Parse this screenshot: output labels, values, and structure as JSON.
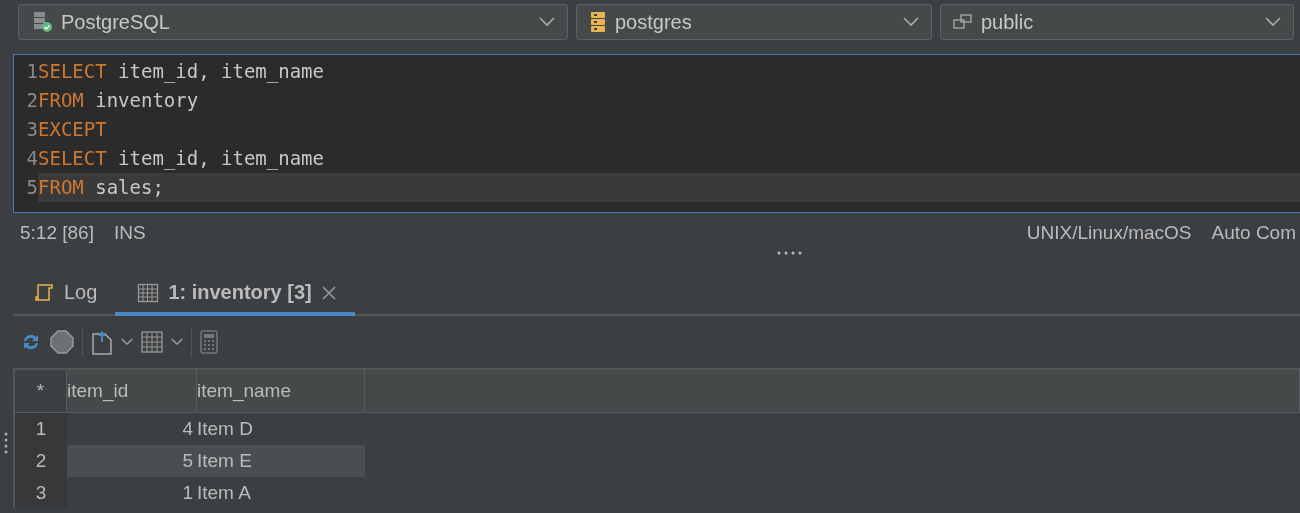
{
  "datasources": [
    {
      "kind": "server",
      "label": "PostgreSQL"
    },
    {
      "kind": "database",
      "label": "postgres"
    },
    {
      "kind": "schema",
      "label": "public"
    }
  ],
  "editor": {
    "lines": [
      {
        "number": "1",
        "current": false,
        "tokens": [
          {
            "kind": "keyword",
            "text": "SELECT"
          },
          {
            "kind": "plain",
            "text": " item_id, item_name"
          }
        ]
      },
      {
        "number": "2",
        "current": false,
        "tokens": [
          {
            "kind": "keyword",
            "text": "FROM"
          },
          {
            "kind": "plain",
            "text": " inventory"
          }
        ]
      },
      {
        "number": "3",
        "current": false,
        "tokens": [
          {
            "kind": "keyword",
            "text": "EXCEPT"
          }
        ]
      },
      {
        "number": "4",
        "current": false,
        "tokens": [
          {
            "kind": "keyword",
            "text": "SELECT"
          },
          {
            "kind": "plain",
            "text": " item_id, item_name"
          }
        ]
      },
      {
        "number": "5",
        "current": true,
        "tokens": [
          {
            "kind": "keyword",
            "text": "FROM"
          },
          {
            "kind": "plain",
            "text": " sales;"
          }
        ]
      }
    ]
  },
  "status_bar": {
    "left": [
      "5:12 [86]",
      "INS"
    ],
    "right": [
      "UNIX/Linux/macOS",
      "Auto Com"
    ]
  },
  "tabs": [
    {
      "kind": "log",
      "label": "Log",
      "selected": false,
      "closable": false
    },
    {
      "kind": "grid",
      "label": "1: inventory [3]",
      "selected": true,
      "closable": true
    }
  ],
  "table": {
    "corner": "*",
    "columns": [
      "item_id",
      "item_name"
    ],
    "rows": [
      {
        "number": "1",
        "cells": [
          "4",
          "Item D"
        ],
        "selected": false
      },
      {
        "number": "2",
        "cells": [
          "5",
          "Item E"
        ],
        "selected": true
      },
      {
        "number": "3",
        "cells": [
          "1",
          "Item A"
        ],
        "selected": false
      }
    ]
  }
}
